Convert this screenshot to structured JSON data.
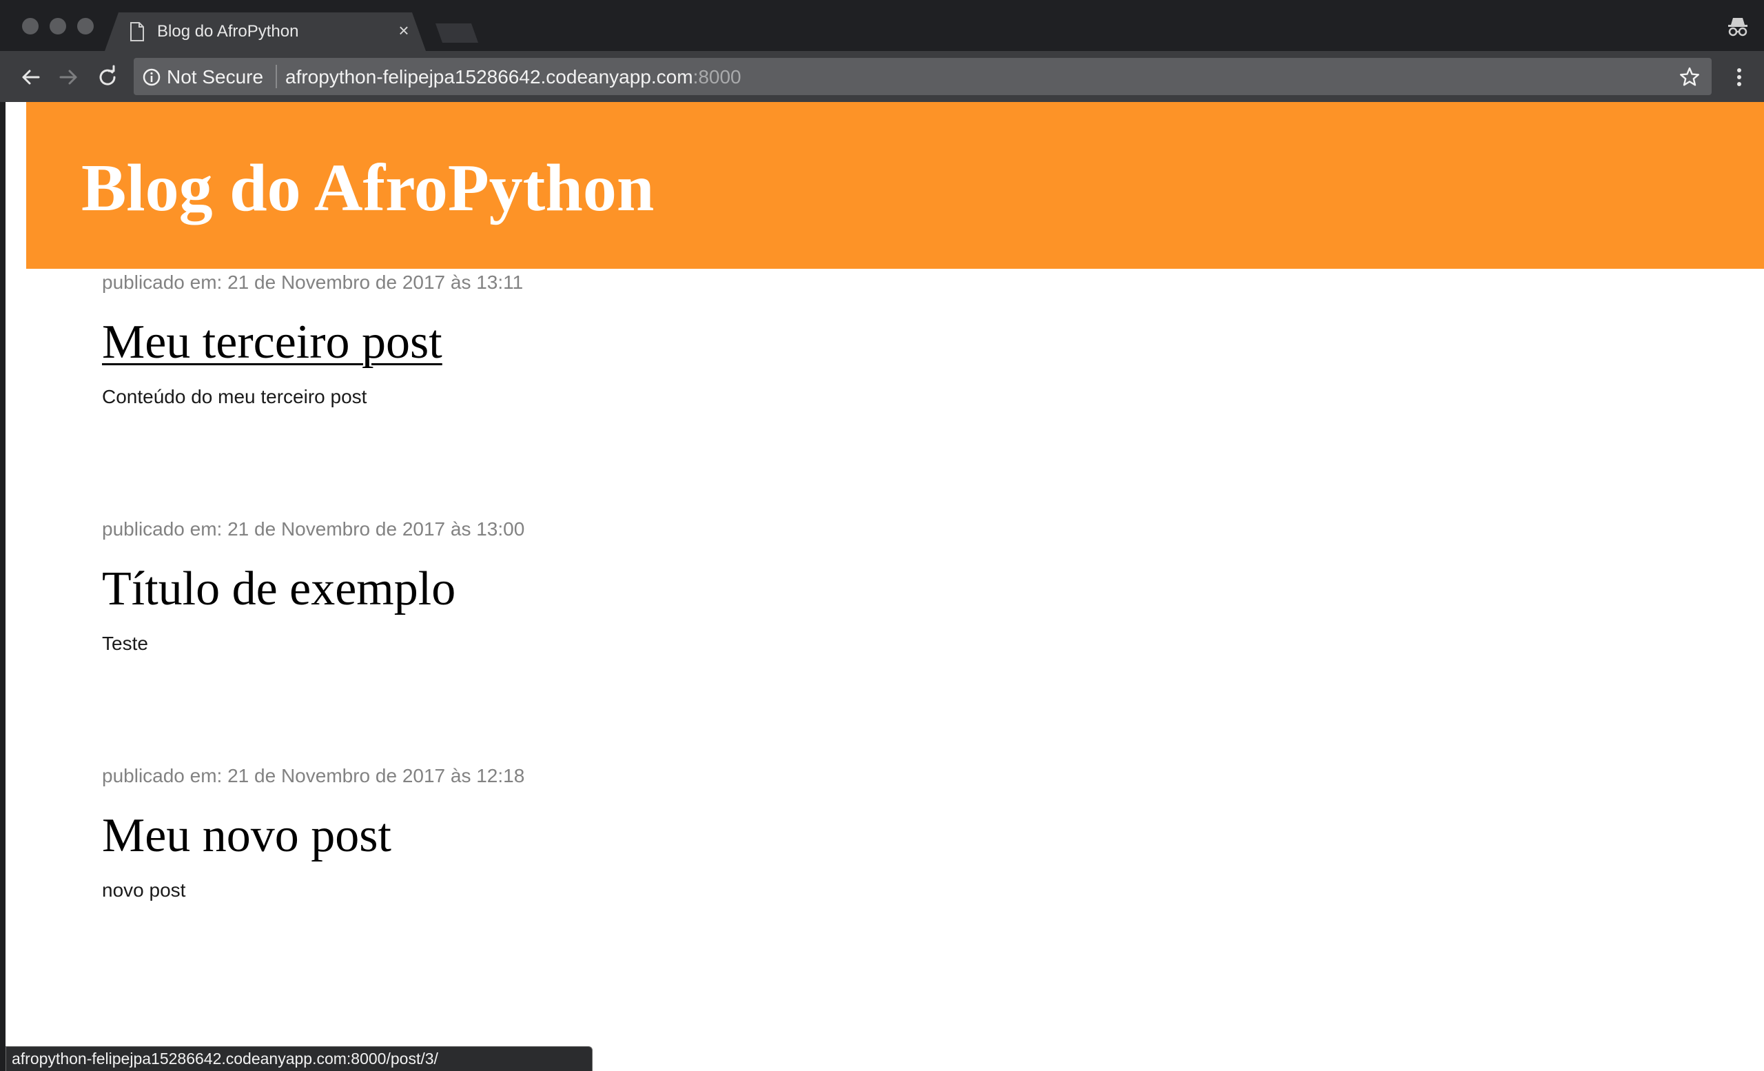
{
  "browser": {
    "tab": {
      "title": "Blog do AfroPython",
      "close_glyph": "×",
      "icon": "document-icon"
    },
    "address_bar": {
      "security_label": "Not Secure",
      "url_host": "afropython-felipejpa15286642.codeanyapp.com",
      "url_port": ":8000"
    },
    "status_bar": {
      "url": "afropython-felipejpa15286642.codeanyapp.com:8000/post/3/"
    },
    "icons": [
      "back-icon",
      "forward-icon",
      "reload-icon",
      "info-icon",
      "star-icon",
      "menu-icon",
      "incognito-icon"
    ]
  },
  "page": {
    "header": {
      "title": "Blog do AfroPython",
      "background_color": "#fd9327"
    },
    "posts": [
      {
        "date": "publicado em: 21 de Novembro de 2017 às 13:11",
        "title": "Meu terceiro post",
        "body": "Conteúdo do meu terceiro post"
      },
      {
        "date": "publicado em: 21 de Novembro de 2017 às 13:00",
        "title": "Título de exemplo",
        "body": "Teste"
      },
      {
        "date": "publicado em: 21 de Novembro de 2017 às 12:18",
        "title": "Meu novo post",
        "body": "novo post"
      }
    ]
  }
}
